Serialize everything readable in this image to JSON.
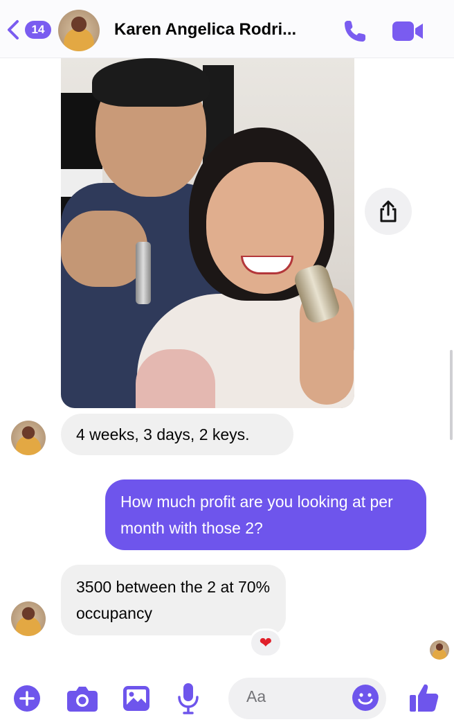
{
  "colors": {
    "accent": "#7a5cf0",
    "outgoing_bubble": "#6e55ec",
    "incoming_bubble": "#f0f0f0",
    "reaction": "#e0202a"
  },
  "header": {
    "back_icon": "chevron-left-icon",
    "unread_count": "14",
    "contact_name": "Karen Angelica Rodri...",
    "call_icon": "phone-icon",
    "video_icon": "video-camera-icon"
  },
  "photo": {
    "share_icon": "share-icon"
  },
  "messages": [
    {
      "direction": "incoming",
      "text": "4 weeks, 3 days, 2 keys."
    },
    {
      "direction": "outgoing",
      "text": "How much profit are you looking at per month with those 2?"
    },
    {
      "direction": "incoming",
      "text": "3500 between the 2 at 70% occupancy",
      "reaction": "❤"
    }
  ],
  "composer": {
    "placeholder": "Aa",
    "icons": [
      "plus-icon",
      "camera-icon",
      "image-icon",
      "microphone-icon",
      "emoji-icon",
      "thumbs-up-icon"
    ]
  }
}
